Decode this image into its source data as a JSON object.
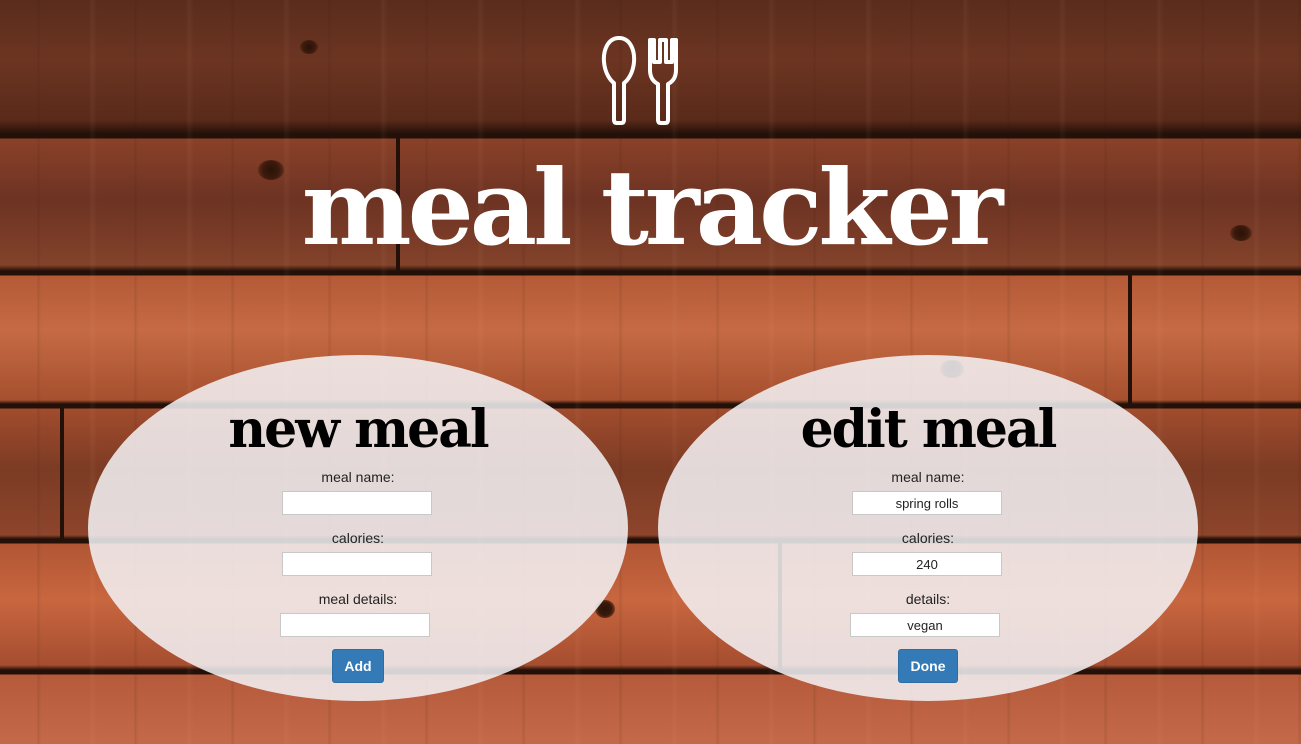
{
  "header": {
    "title": "meal tracker",
    "logo_icon": "spoon-fork-icon"
  },
  "new_meal": {
    "title": "new meal",
    "name_label": "meal name:",
    "name_value": "",
    "calories_label": "calories:",
    "calories_value": "",
    "details_label": "meal details:",
    "details_value": "",
    "button_label": "Add"
  },
  "edit_meal": {
    "title": "edit meal",
    "name_label": "meal name:",
    "name_value": "spring rolls",
    "calories_label": "calories:",
    "calories_value": "240",
    "details_label": "details:",
    "details_value": "vegan",
    "button_label": "Done"
  },
  "colors": {
    "button": "#337ab7",
    "title": "#ffffff",
    "wood": "#7a3a22"
  }
}
